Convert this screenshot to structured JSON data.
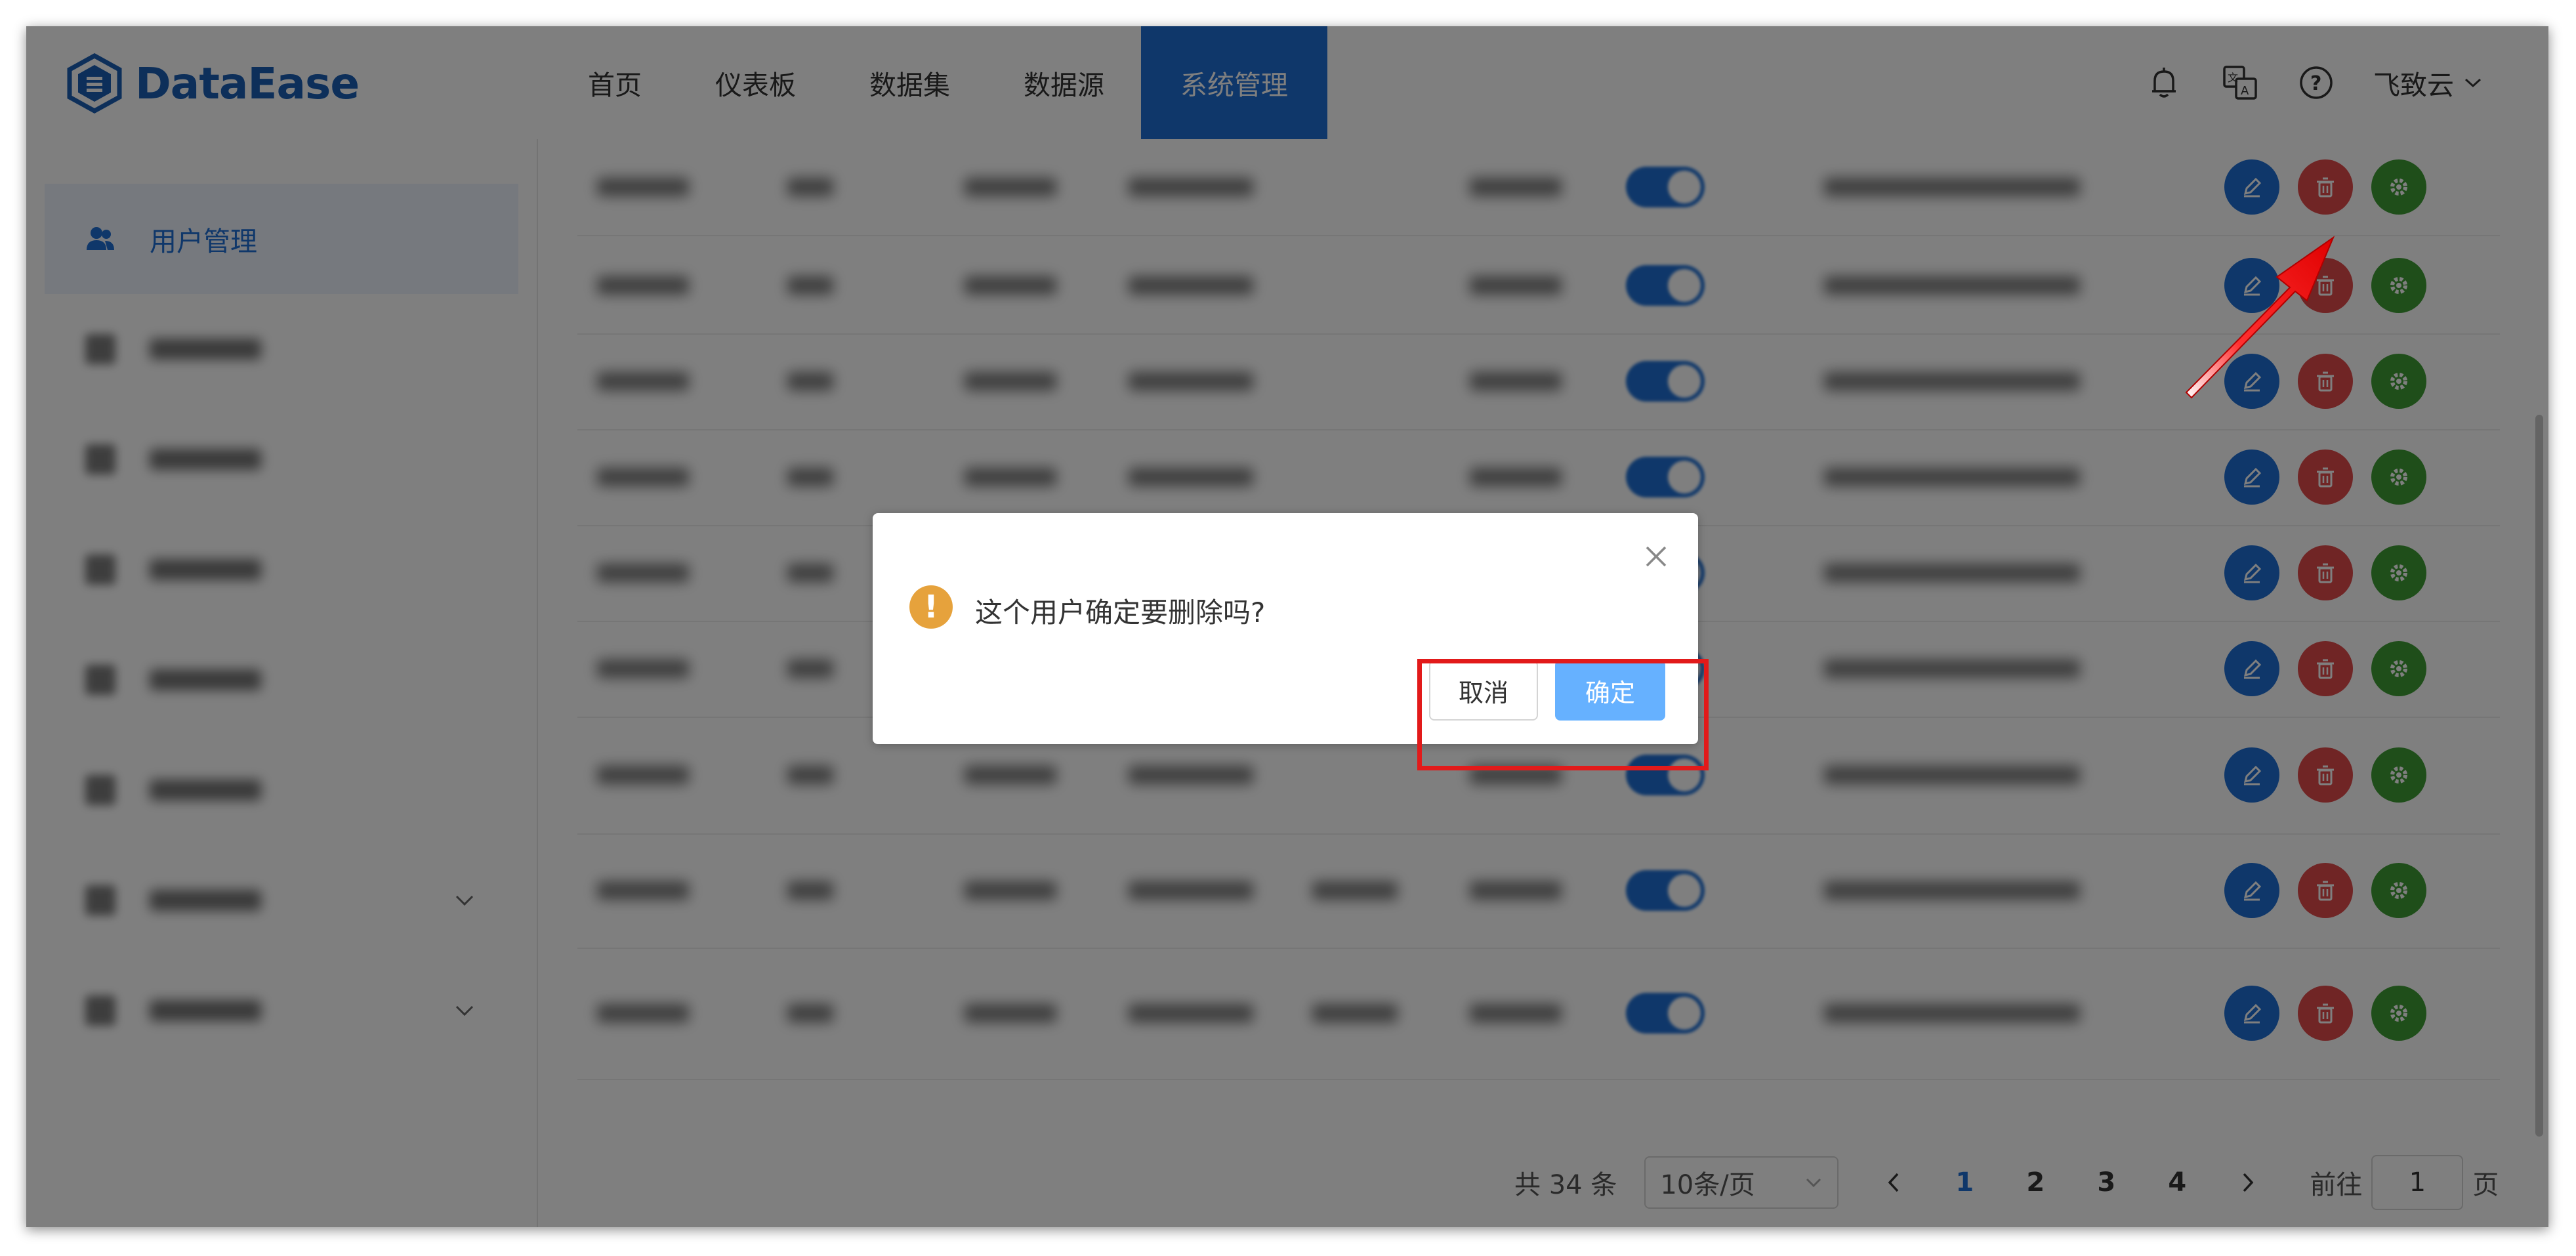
{
  "app": {
    "logo_text": "DataEase"
  },
  "nav": [
    {
      "label": "首页"
    },
    {
      "label": "仪表板"
    },
    {
      "label": "数据集"
    },
    {
      "label": "数据源"
    },
    {
      "label": "系统管理"
    }
  ],
  "header": {
    "user_name": "飞致云"
  },
  "sidebar": {
    "active_label": "用户管理"
  },
  "pagination": {
    "total": "共 34 条",
    "page_size": "10条/页",
    "pages": [
      "1",
      "2",
      "3",
      "4"
    ],
    "current": "1",
    "goto_prefix": "前往",
    "goto_value": "1",
    "goto_suffix": "页"
  },
  "dialog": {
    "message": "这个用户确定要删除吗?",
    "cancel_label": "取消",
    "confirm_label": "确定"
  },
  "colors": {
    "primary": "#1f6fd4",
    "danger": "#e04a4a",
    "success": "#3f9c35",
    "warning": "#e6a23c",
    "confirm": "#66b1ff",
    "highlight": "#e21a1a"
  }
}
